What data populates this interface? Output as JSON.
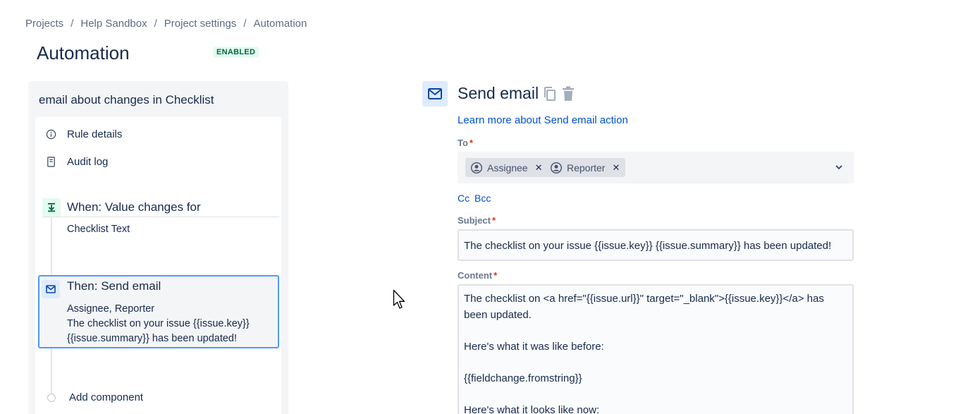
{
  "breadcrumb": {
    "items": [
      "Projects",
      "Help Sandbox",
      "Project settings",
      "Automation"
    ],
    "separator": "/"
  },
  "page": {
    "title": "Automation",
    "status": "ENABLED"
  },
  "rule": {
    "name": "email about changes in Checklist",
    "menu": [
      {
        "label": "Rule details",
        "icon": "info-icon"
      },
      {
        "label": "Audit log",
        "icon": "document-icon"
      }
    ],
    "trigger": {
      "title": "When: Value changes for",
      "description": "Checklist Text",
      "icon": "trigger-icon"
    },
    "action": {
      "title": "Then: Send email",
      "line1": "Assignee, Reporter",
      "line2": "The checklist on your issue {{issue.key}} {{issue.summary}} has been updated!",
      "icon": "mail-icon"
    },
    "add_component": "Add component"
  },
  "editor": {
    "title": "Send email",
    "learn_more": "Learn more about Send email action",
    "to": {
      "label": "To",
      "required": "*",
      "recipients": [
        "Assignee",
        "Reporter"
      ]
    },
    "cc_label": "Cc",
    "bcc_label": "Bcc",
    "subject": {
      "label": "Subject",
      "required": "*",
      "value": "The checklist on your issue {{issue.key}} {{issue.summary}} has been updated!"
    },
    "content": {
      "label": "Content",
      "required": "*",
      "value": "The checklist on <a href=\"{{issue.url}}\" target=\"_blank\">{{issue.key}}</a> has been updated.\n\nHere's what it was like before:\n\n{{fieldchange.fromstring}}\n\nHere's what it looks like now:"
    }
  },
  "colors": {
    "link": "#0052cc",
    "enabled_badge_bg": "#e3fcef",
    "enabled_badge_text": "#006644",
    "selected_border": "#4c9aff"
  }
}
